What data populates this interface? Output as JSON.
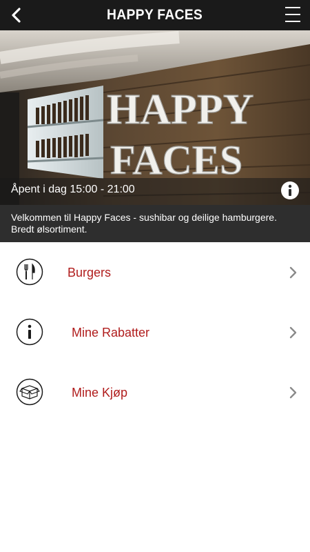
{
  "header": {
    "title": "HAPPY FACES",
    "back_icon": "back-arrow-icon",
    "menu_icon": "hamburger-menu-icon"
  },
  "hero": {
    "sign_line1": "HAPPY",
    "sign_line2": "FACES",
    "opening_hours": "Åpent i dag 15:00 - 21:00",
    "info_icon": "info-icon"
  },
  "welcome": {
    "text": "Velkommen til Happy Faces - sushibar og deilige hamburgere. Bredt ølsortiment."
  },
  "menu_items": [
    {
      "label": "Burgers",
      "icon": "cutlery-icon"
    },
    {
      "label": "Mine Rabatter",
      "icon": "info-icon"
    },
    {
      "label": "Mine Kjøp",
      "icon": "box-icon"
    }
  ],
  "colors": {
    "topbar": "#1a1a1a",
    "welcome_bar": "#2e2e2e",
    "item_label": "#b01c1c",
    "chevron": "#8a8a8a"
  }
}
